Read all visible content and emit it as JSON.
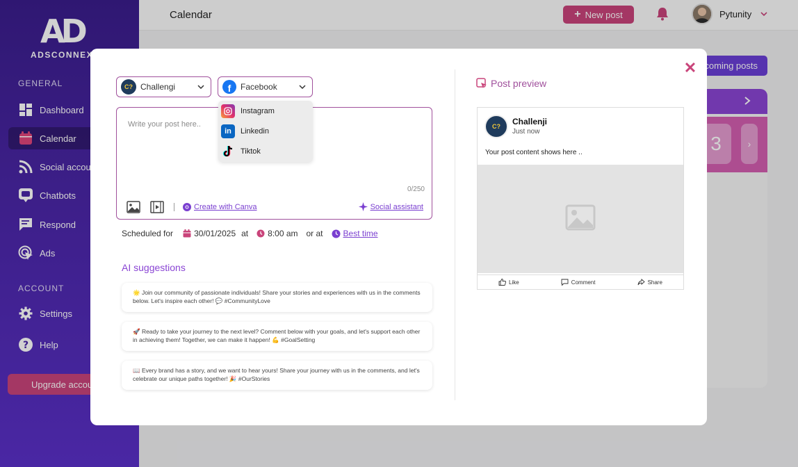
{
  "brand": {
    "logo_mark": "AD",
    "logo_text": "ADSCONNEX"
  },
  "sidebar": {
    "section_general": "GENERAL",
    "section_account": "ACCOUNT",
    "items": [
      {
        "label": "Dashboard",
        "icon": "dashboard-icon"
      },
      {
        "label": "Calendar",
        "icon": "calendar-icon"
      },
      {
        "label": "Social accounts",
        "icon": "rss-icon"
      },
      {
        "label": "Chatbots",
        "icon": "chatbot-icon"
      },
      {
        "label": "Respond",
        "icon": "message-icon"
      },
      {
        "label": "Ads",
        "icon": "cursor-icon"
      }
    ],
    "account_items": [
      {
        "label": "Settings",
        "icon": "gear-icon"
      },
      {
        "label": "Help",
        "icon": "help-icon"
      }
    ],
    "upgrade_label": "Upgrade account"
  },
  "topbar": {
    "title": "Calendar",
    "new_post_label": "New post",
    "username": "Pytunity"
  },
  "background": {
    "upcoming_label": "Upcoming posts",
    "day_number": "3"
  },
  "modal": {
    "account_select": "Challengi",
    "platform_select": "Facebook",
    "platform_options": [
      "Instagram",
      "Linkedin",
      "Tiktok"
    ],
    "composer_placeholder": "Write your post here..",
    "char_count": "0/250",
    "canva_label": "Create with Canva",
    "assistant_label": "Social assistant",
    "schedule": {
      "label": "Scheduled for",
      "date": "30/01/2025",
      "at": "at",
      "time": "8:00 am",
      "or_at": "or at",
      "best_time": "Best time"
    },
    "ai_title": "AI suggestions",
    "suggestions": [
      "🌟 Join our community of passionate individuals! Share your stories and experiences with us in the comments below. Let's inspire each other! 💬 #CommunityLove",
      "🚀 Ready to take your journey to the next level? Comment below with your goals, and let's support each other in achieving them! Together, we can make it happen! 💪 #GoalSetting",
      "📖 Every brand has a story, and we want to hear yours! Share your journey with us in the comments, and let's celebrate our unique paths together! 🎉 #OurStories"
    ],
    "preview": {
      "title": "Post preview",
      "page_name": "Challenji",
      "time": "Just now",
      "content": "Your post content shows here ..",
      "actions": [
        "Like",
        "Comment",
        "Share"
      ]
    }
  },
  "colors": {
    "accent": "#c9447a",
    "purple": "#7a3fd0",
    "sidebar": "#4a26a6"
  }
}
